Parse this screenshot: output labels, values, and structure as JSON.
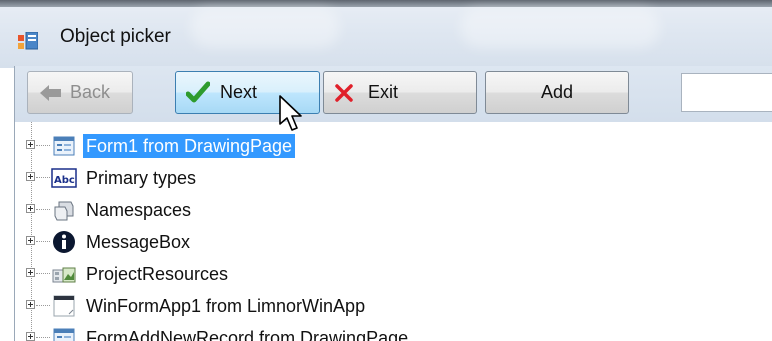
{
  "window": {
    "title": "Object picker"
  },
  "toolbar": {
    "back_label": "Back",
    "next_label": "Next",
    "exit_label": "Exit",
    "add_label": "Add",
    "search_value": ""
  },
  "tree": {
    "items": [
      {
        "label": "Form1 from DrawingPage",
        "icon": "form-icon",
        "selected": true
      },
      {
        "label": "Primary types",
        "icon": "abc-type-icon",
        "selected": false
      },
      {
        "label": "Namespaces",
        "icon": "namespace-icon",
        "selected": false
      },
      {
        "label": "MessageBox",
        "icon": "info-icon",
        "selected": false
      },
      {
        "label": "ProjectResources",
        "icon": "resources-icon",
        "selected": false
      },
      {
        "label": "WinFormApp1 from LimnorWinApp",
        "icon": "app-icon",
        "selected": false
      },
      {
        "label": "FormAddNewRecord from DrawingPage",
        "icon": "form-icon",
        "selected": false
      }
    ]
  },
  "colors": {
    "selection": "#3399ff",
    "check": "#2e9b2e",
    "exit_x": "#e0202a"
  }
}
